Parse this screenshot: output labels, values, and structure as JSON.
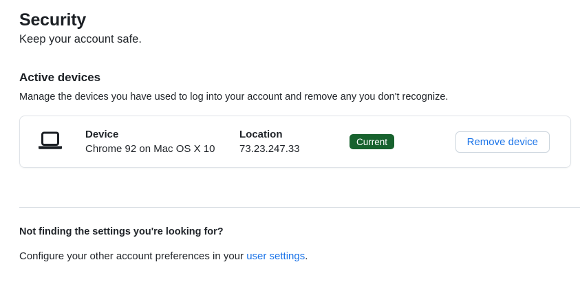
{
  "page": {
    "title": "Security",
    "subtitle": "Keep your account safe."
  },
  "active_devices": {
    "heading": "Active devices",
    "description": "Manage the devices you have used to log into your account and remove any you don't recognize.",
    "device": {
      "icon": "laptop-icon",
      "device_label": "Device",
      "device_value": "Chrome 92 on Mac OS X 10",
      "location_label": "Location",
      "location_value": "73.23.247.33",
      "status": "Current",
      "remove_label": "Remove device"
    }
  },
  "footer": {
    "heading": "Not finding the settings you're looking for?",
    "text_before_link": "Configure your other account preferences in your ",
    "link": "user settings",
    "text_after_link": "."
  },
  "colors": {
    "text": "#1f2328",
    "badge_bg": "#17622e",
    "badge_text": "#ffffff",
    "accent_blue": "#1a73e8",
    "card_border": "#dfe3e8",
    "button_border": "#ccd5dd",
    "divider": "#d8dee3"
  }
}
